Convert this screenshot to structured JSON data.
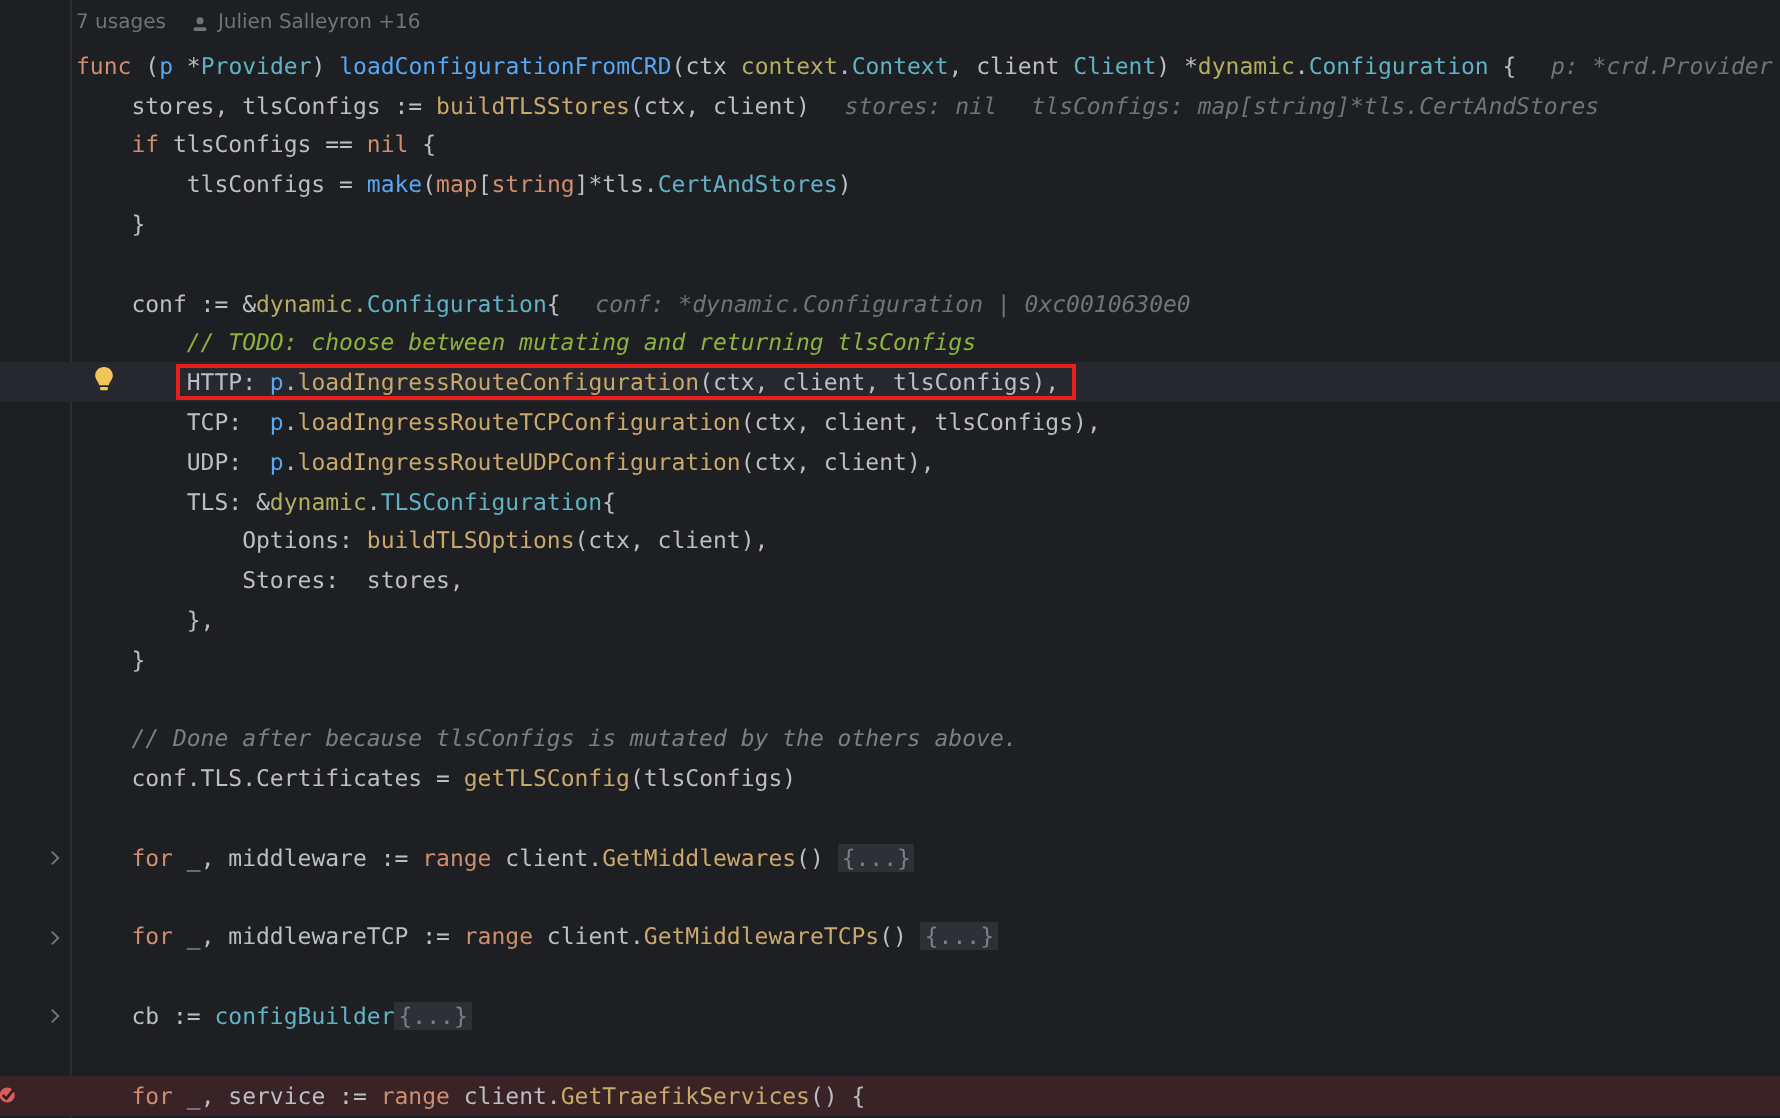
{
  "header": {
    "usages": "7 usages",
    "authors": "Julien Salleyron +16"
  },
  "lines": [
    {
      "kind": "code",
      "current": false,
      "breakpoint": false,
      "boxed": false,
      "tokens": [
        {
          "kind": "kw",
          "t": "func"
        },
        {
          "kind": "plain",
          "t": " ("
        },
        {
          "kind": "recv",
          "t": "p"
        },
        {
          "kind": "plain",
          "t": " *"
        },
        {
          "kind": "type",
          "t": "Provider"
        },
        {
          "kind": "plain",
          "t": ") "
        },
        {
          "kind": "decl",
          "t": "loadConfigurationFromCRD"
        },
        {
          "kind": "plain",
          "t": "(ctx "
        },
        {
          "kind": "pkg",
          "t": "context"
        },
        {
          "kind": "plain",
          "t": "."
        },
        {
          "kind": "type",
          "t": "Context"
        },
        {
          "kind": "plain",
          "t": ", client "
        },
        {
          "kind": "type",
          "t": "Client"
        },
        {
          "kind": "plain",
          "t": ") *"
        },
        {
          "kind": "pkg",
          "t": "dynamic"
        },
        {
          "kind": "plain",
          "t": "."
        },
        {
          "kind": "type",
          "t": "Configuration"
        },
        {
          "kind": "plain",
          "t": " {"
        }
      ],
      "hints": [
        "p: *crd.Provider"
      ],
      "children": [
        {
          "kind": "code",
          "current": false,
          "breakpoint": false,
          "boxed": false,
          "tokens": [
            {
              "kind": "plain",
              "t": "stores, tlsConfigs := "
            },
            {
              "kind": "call",
              "t": "buildTLSStores"
            },
            {
              "kind": "plain",
              "t": "(ctx, client)"
            }
          ],
          "hints": [
            "stores: nil",
            "tlsConfigs: map[string]*tls.CertAndStores"
          ]
        },
        {
          "kind": "code",
          "current": false,
          "breakpoint": false,
          "boxed": false,
          "tokens": [
            {
              "kind": "kw",
              "t": "if"
            },
            {
              "kind": "plain",
              "t": " tlsConfigs == "
            },
            {
              "kind": "kw",
              "t": "nil"
            },
            {
              "kind": "plain",
              "t": " {"
            }
          ],
          "children": [
            {
              "kind": "code",
              "current": false,
              "breakpoint": false,
              "boxed": false,
              "tokens": [
                {
                  "kind": "plain",
                  "t": "tlsConfigs = "
                },
                {
                  "kind": "builtin",
                  "t": "make"
                },
                {
                  "kind": "plain",
                  "t": "("
                },
                {
                  "kind": "kw",
                  "t": "map"
                },
                {
                  "kind": "plain",
                  "t": "["
                },
                {
                  "kind": "kw",
                  "t": "string"
                },
                {
                  "kind": "plain",
                  "t": "]*tls."
                },
                {
                  "kind": "type",
                  "t": "CertAndStores"
                },
                {
                  "kind": "plain",
                  "t": ")"
                }
              ]
            }
          ]
        },
        {
          "kind": "code",
          "current": false,
          "breakpoint": false,
          "boxed": false,
          "tokens": [
            {
              "kind": "plain",
              "t": "}"
            }
          ]
        },
        {
          "kind": "blank"
        },
        {
          "kind": "code",
          "current": false,
          "breakpoint": false,
          "boxed": false,
          "tokens": [
            {
              "kind": "plain",
              "t": "conf := &"
            },
            {
              "kind": "pkg",
              "t": "dynamic."
            },
            {
              "kind": "type",
              "t": "Configuration"
            },
            {
              "kind": "plain",
              "t": "{"
            }
          ],
          "hints": [
            "conf: *dynamic.Configuration | 0xc0010630e0"
          ],
          "children": [
            {
              "kind": "code",
              "current": false,
              "breakpoint": false,
              "boxed": false,
              "tokens": [
                {
                  "kind": "todo",
                  "t": "// TODO: choose between mutating and returning tlsConfigs"
                }
              ]
            },
            {
              "kind": "code",
              "current": true,
              "breakpoint": false,
              "boxed": true,
              "tokens": [
                {
                  "kind": "plain",
                  "t": "HTTP: "
                },
                {
                  "kind": "recv",
                  "t": "p"
                },
                {
                  "kind": "plain",
                  "t": "."
                },
                {
                  "kind": "call",
                  "t": "loadIngressRouteConfiguration"
                },
                {
                  "kind": "plain",
                  "t": "(ctx, client, tlsConfigs),"
                }
              ]
            },
            {
              "kind": "code",
              "current": false,
              "breakpoint": false,
              "boxed": false,
              "tokens": [
                {
                  "kind": "plain",
                  "t": "TCP:  "
                },
                {
                  "kind": "recv",
                  "t": "p"
                },
                {
                  "kind": "plain",
                  "t": "."
                },
                {
                  "kind": "call",
                  "t": "loadIngressRouteTCPConfiguration"
                },
                {
                  "kind": "plain",
                  "t": "(ctx, client, tlsConfigs),"
                }
              ]
            },
            {
              "kind": "code",
              "current": false,
              "breakpoint": false,
              "boxed": false,
              "tokens": [
                {
                  "kind": "plain",
                  "t": "UDP:  "
                },
                {
                  "kind": "recv",
                  "t": "p"
                },
                {
                  "kind": "plain",
                  "t": "."
                },
                {
                  "kind": "call",
                  "t": "loadIngressRouteUDPConfiguration"
                },
                {
                  "kind": "plain",
                  "t": "(ctx, client),"
                }
              ]
            },
            {
              "kind": "code",
              "current": false,
              "breakpoint": false,
              "boxed": false,
              "tokens": [
                {
                  "kind": "plain",
                  "t": "TLS: &"
                },
                {
                  "kind": "pkg",
                  "t": "dynamic"
                },
                {
                  "kind": "plain",
                  "t": "."
                },
                {
                  "kind": "type",
                  "t": "TLSConfiguration"
                },
                {
                  "kind": "plain",
                  "t": "{"
                }
              ],
              "children": [
                {
                  "kind": "code",
                  "current": false,
                  "breakpoint": false,
                  "boxed": false,
                  "tokens": [
                    {
                      "kind": "plain",
                      "t": "Options: "
                    },
                    {
                      "kind": "call",
                      "t": "buildTLSOptions"
                    },
                    {
                      "kind": "plain",
                      "t": "(ctx, client),"
                    }
                  ]
                },
                {
                  "kind": "code",
                  "current": false,
                  "breakpoint": false,
                  "boxed": false,
                  "tokens": [
                    {
                      "kind": "plain",
                      "t": "Stores:  stores,"
                    }
                  ]
                }
              ]
            },
            {
              "kind": "code",
              "current": false,
              "breakpoint": false,
              "boxed": false,
              "tokens": [
                {
                  "kind": "plain",
                  "t": "},"
                }
              ]
            }
          ]
        },
        {
          "kind": "code",
          "current": false,
          "breakpoint": false,
          "boxed": false,
          "tokens": [
            {
              "kind": "plain",
              "t": "}"
            }
          ]
        },
        {
          "kind": "blank"
        },
        {
          "kind": "code",
          "current": false,
          "breakpoint": false,
          "boxed": false,
          "tokens": [
            {
              "kind": "comment",
              "t": "// Done after because tlsConfigs is mutated by the others above."
            }
          ]
        },
        {
          "kind": "code",
          "current": false,
          "breakpoint": false,
          "boxed": false,
          "tokens": [
            {
              "kind": "plain",
              "t": "conf.TLS.Certificates = "
            },
            {
              "kind": "call",
              "t": "getTLSConfig"
            },
            {
              "kind": "plain",
              "t": "(tlsConfigs)"
            }
          ]
        },
        {
          "kind": "blank"
        },
        {
          "kind": "code",
          "current": false,
          "breakpoint": false,
          "boxed": false,
          "tokens": [
            {
              "kind": "kw",
              "t": "for"
            },
            {
              "kind": "plain",
              "t": " _, middleware := "
            },
            {
              "kind": "kw",
              "t": "range"
            },
            {
              "kind": "plain",
              "t": " client."
            },
            {
              "kind": "call",
              "t": "GetMiddlewares"
            },
            {
              "kind": "plain",
              "t": "() "
            }
          ],
          "fold": "{...}"
        },
        {
          "kind": "blank"
        },
        {
          "kind": "code",
          "current": false,
          "breakpoint": false,
          "boxed": false,
          "tokens": [
            {
              "kind": "kw",
              "t": "for"
            },
            {
              "kind": "plain",
              "t": " _, middlewareTCP := "
            },
            {
              "kind": "kw",
              "t": "range"
            },
            {
              "kind": "plain",
              "t": " client."
            },
            {
              "kind": "call",
              "t": "GetMiddlewareTCPs"
            },
            {
              "kind": "plain",
              "t": "() "
            }
          ],
          "fold": "{...}"
        },
        {
          "kind": "blank"
        },
        {
          "kind": "code",
          "current": false,
          "breakpoint": false,
          "boxed": false,
          "tokens": [
            {
              "kind": "plain",
              "t": "cb := "
            },
            {
              "kind": "type",
              "t": "configBuilder"
            }
          ],
          "fold": "{...}"
        },
        {
          "kind": "blank"
        },
        {
          "kind": "code",
          "current": false,
          "breakpoint": true,
          "boxed": false,
          "tokens": [
            {
              "kind": "kw",
              "t": "for"
            },
            {
              "kind": "plain",
              "t": " _, service := "
            },
            {
              "kind": "kw",
              "t": "range"
            },
            {
              "kind": "plain",
              "t": " client."
            },
            {
              "kind": "call",
              "t": "GetTraefikServices"
            },
            {
              "kind": "plain",
              "t": "() {"
            }
          ]
        }
      ]
    }
  ]
}
